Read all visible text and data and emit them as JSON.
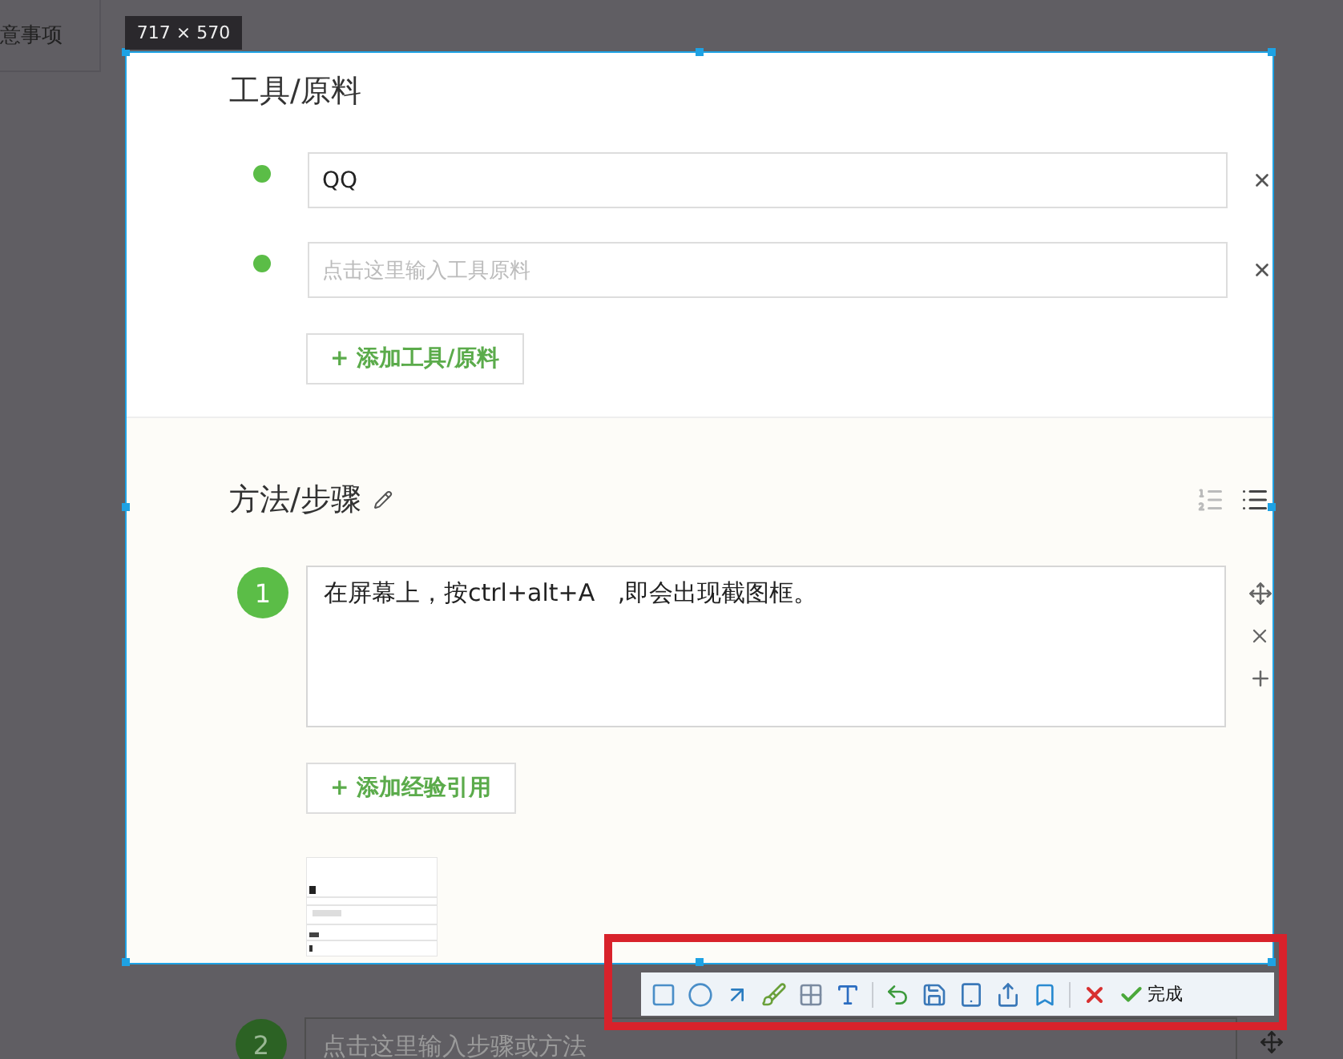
{
  "sidebar": {
    "items": [
      {
        "label": "意事项"
      }
    ]
  },
  "capture": {
    "size_label": "717 × 570"
  },
  "tools_section": {
    "title": "工具/原料",
    "items": [
      {
        "value": "QQ"
      },
      {
        "placeholder": "点击这里输入工具原料"
      }
    ],
    "add_button": "+ 添加工具/原料"
  },
  "steps_section": {
    "title": "方法/步骤",
    "steps": [
      {
        "number": "1",
        "text": "在屏幕上，按ctrl+alt+A   ,即会出现截图框。",
        "add_button": "+ 添加经验引用"
      },
      {
        "number": "2",
        "placeholder": "点击这里输入步骤或方法"
      }
    ]
  },
  "toolbar": {
    "done_label": "完成"
  }
}
